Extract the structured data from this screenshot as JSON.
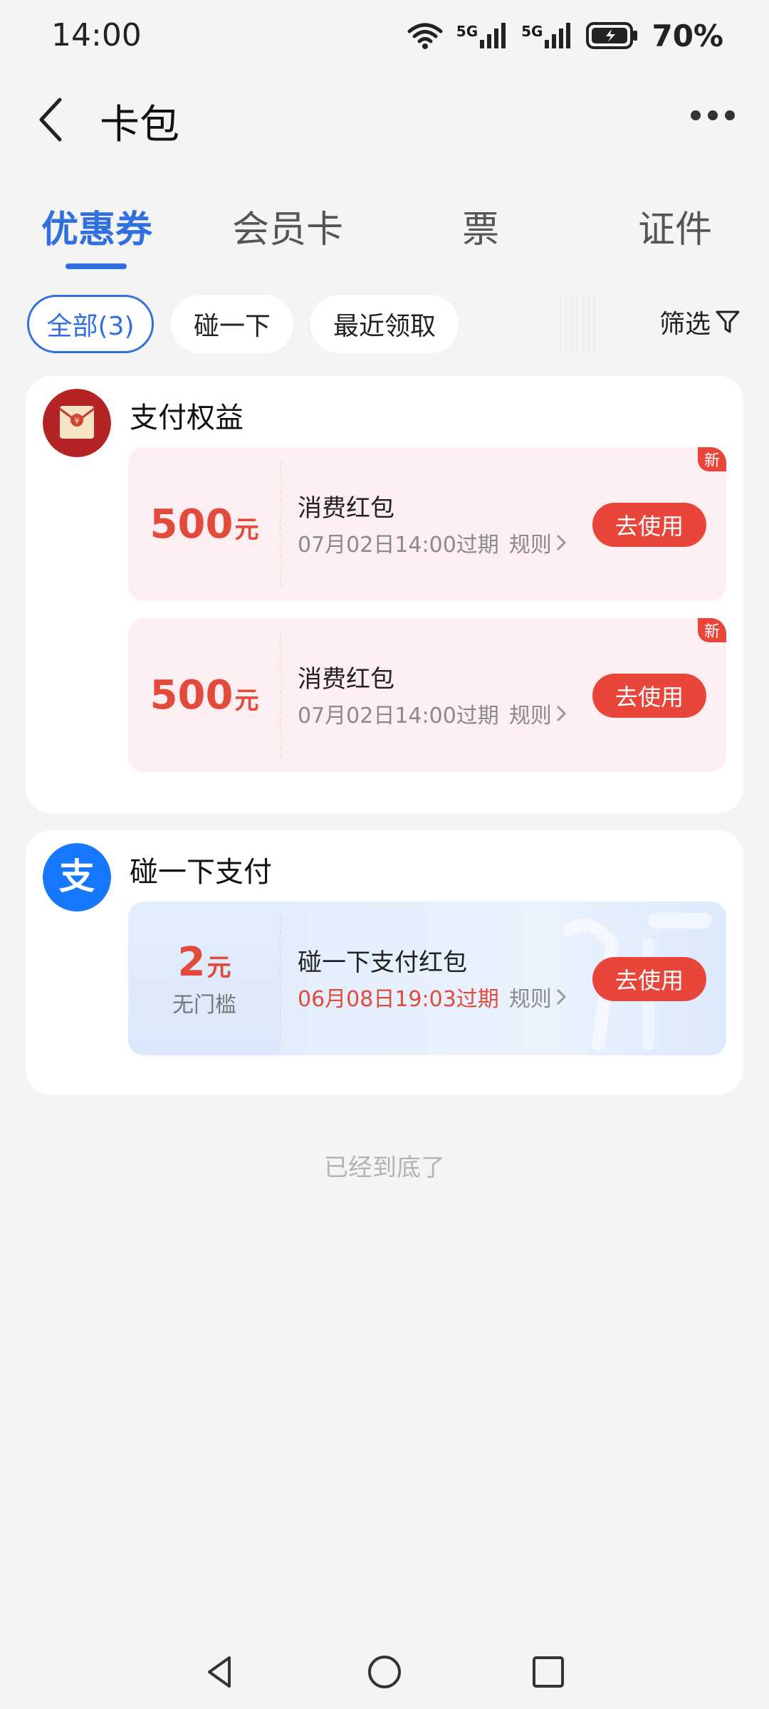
{
  "status_bar": {
    "time": "14:00",
    "battery": "70%",
    "signal_1": "5G",
    "signal_2": "5G"
  },
  "header": {
    "title": "卡包"
  },
  "tabs": [
    {
      "label": "优惠券",
      "active": true
    },
    {
      "label": "会员卡",
      "active": false
    },
    {
      "label": "票",
      "active": false
    },
    {
      "label": "证件",
      "active": false
    }
  ],
  "filters": {
    "chips": [
      {
        "label": "全部(3)",
        "active": true
      },
      {
        "label": "碰一下",
        "active": false
      },
      {
        "label": "最近领取",
        "active": false
      }
    ],
    "filter_label": "筛选"
  },
  "groups": [
    {
      "title": "支付权益",
      "logo_icon": "red-envelope-icon",
      "coupons": [
        {
          "amount": "500",
          "unit": "元",
          "name": "消费红包",
          "expiry": "07月02日14:00过期",
          "rules": "规则",
          "button": "去使用",
          "badge": "新"
        },
        {
          "amount": "500",
          "unit": "元",
          "name": "消费红包",
          "expiry": "07月02日14:00过期",
          "rules": "规则",
          "button": "去使用",
          "badge": "新"
        }
      ]
    },
    {
      "title": "碰一下支付",
      "logo_icon": "alipay-icon",
      "coupons": [
        {
          "amount": "2",
          "unit": "元",
          "sub": "无门槛",
          "name": "碰一下支付红包",
          "expiry": "06月08日19:03过期",
          "rules": "规则",
          "button": "去使用"
        }
      ]
    }
  ],
  "footer": {
    "bottom_note": "已经到底了"
  },
  "colors": {
    "accent": "#2f6fe0",
    "red": "#e8463a",
    "background": "#f4f4f4"
  }
}
